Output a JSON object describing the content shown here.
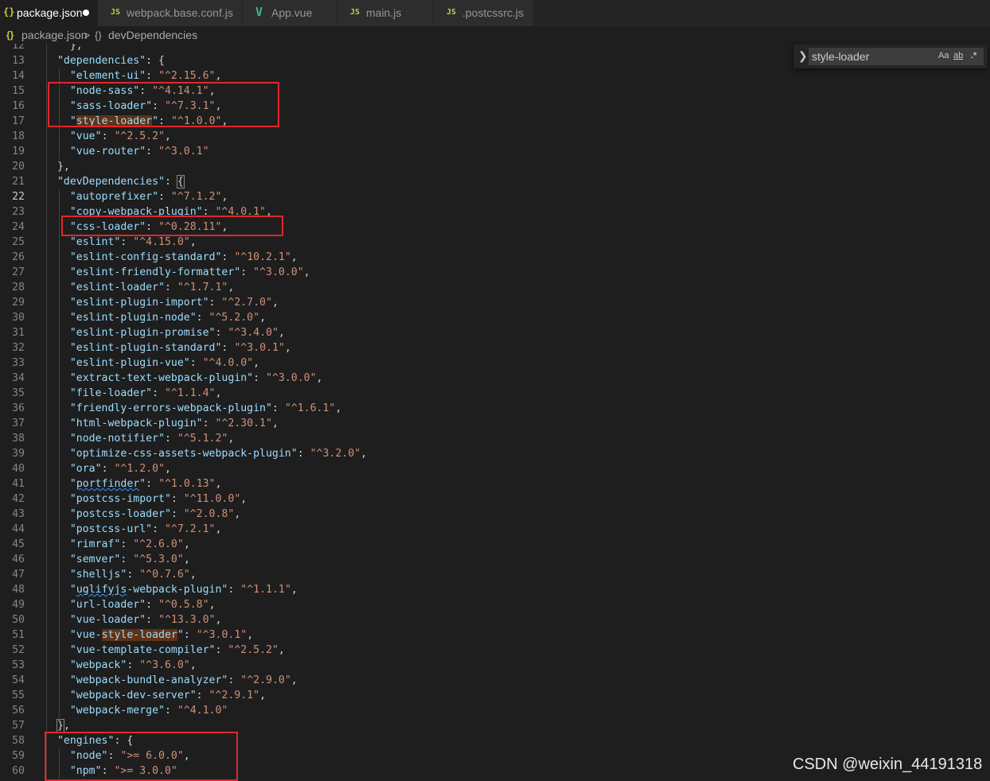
{
  "tabs": [
    {
      "label": "package.json",
      "icon": "{}",
      "active": true,
      "modified": true
    },
    {
      "label": "webpack.base.conf.js",
      "icon": "JS",
      "active": false
    },
    {
      "label": "App.vue",
      "icon": "V",
      "active": false
    },
    {
      "label": "main.js",
      "icon": "JS",
      "active": false
    },
    {
      "label": ".postcssrc.js",
      "icon": "JS",
      "active": false
    }
  ],
  "breadcrumb": {
    "file_icon": "{}",
    "file": "package.json",
    "separator": ">",
    "symbol_icon": "{}",
    "symbol": "devDependencies"
  },
  "find": {
    "value": "style-loader",
    "match_case": "Aa",
    "whole_word": "ab",
    "regex": ".*"
  },
  "watermark": "CSDN @weixin_44191318",
  "editor": {
    "current_line": 22,
    "lines": [
      {
        "n": 12,
        "t": "    },"
      },
      {
        "n": 13,
        "t": "  \"dependencies\": {"
      },
      {
        "n": 14,
        "t": "    \"element-ui\": \"^2.15.6\","
      },
      {
        "n": 15,
        "t": "    \"node-sass\": \"^4.14.1\","
      },
      {
        "n": 16,
        "t": "    \"sass-loader\": \"^7.3.1\","
      },
      {
        "n": 17,
        "t": "    \"style-loader\": \"^1.0.0\","
      },
      {
        "n": 18,
        "t": "    \"vue\": \"^2.5.2\","
      },
      {
        "n": 19,
        "t": "    \"vue-router\": \"^3.0.1\""
      },
      {
        "n": 20,
        "t": "  },"
      },
      {
        "n": 21,
        "t": "  \"devDependencies\": {"
      },
      {
        "n": 22,
        "t": "    \"autoprefixer\": \"^7.1.2\","
      },
      {
        "n": 23,
        "t": "    \"copy-webpack-plugin\": \"^4.0.1\","
      },
      {
        "n": 24,
        "t": "    \"css-loader\": \"^0.28.11\","
      },
      {
        "n": 25,
        "t": "    \"eslint\": \"^4.15.0\","
      },
      {
        "n": 26,
        "t": "    \"eslint-config-standard\": \"^10.2.1\","
      },
      {
        "n": 27,
        "t": "    \"eslint-friendly-formatter\": \"^3.0.0\","
      },
      {
        "n": 28,
        "t": "    \"eslint-loader\": \"^1.7.1\","
      },
      {
        "n": 29,
        "t": "    \"eslint-plugin-import\": \"^2.7.0\","
      },
      {
        "n": 30,
        "t": "    \"eslint-plugin-node\": \"^5.2.0\","
      },
      {
        "n": 31,
        "t": "    \"eslint-plugin-promise\": \"^3.4.0\","
      },
      {
        "n": 32,
        "t": "    \"eslint-plugin-standard\": \"^3.0.1\","
      },
      {
        "n": 33,
        "t": "    \"eslint-plugin-vue\": \"^4.0.0\","
      },
      {
        "n": 34,
        "t": "    \"extract-text-webpack-plugin\": \"^3.0.0\","
      },
      {
        "n": 35,
        "t": "    \"file-loader\": \"^1.1.4\","
      },
      {
        "n": 36,
        "t": "    \"friendly-errors-webpack-plugin\": \"^1.6.1\","
      },
      {
        "n": 37,
        "t": "    \"html-webpack-plugin\": \"^2.30.1\","
      },
      {
        "n": 38,
        "t": "    \"node-notifier\": \"^5.1.2\","
      },
      {
        "n": 39,
        "t": "    \"optimize-css-assets-webpack-plugin\": \"^3.2.0\","
      },
      {
        "n": 40,
        "t": "    \"ora\": \"^1.2.0\","
      },
      {
        "n": 41,
        "t": "    \"portfinder\": \"^1.0.13\","
      },
      {
        "n": 42,
        "t": "    \"postcss-import\": \"^11.0.0\","
      },
      {
        "n": 43,
        "t": "    \"postcss-loader\": \"^2.0.8\","
      },
      {
        "n": 44,
        "t": "    \"postcss-url\": \"^7.2.1\","
      },
      {
        "n": 45,
        "t": "    \"rimraf\": \"^2.6.0\","
      },
      {
        "n": 46,
        "t": "    \"semver\": \"^5.3.0\","
      },
      {
        "n": 47,
        "t": "    \"shelljs\": \"^0.7.6\","
      },
      {
        "n": 48,
        "t": "    \"uglifyjs-webpack-plugin\": \"^1.1.1\","
      },
      {
        "n": 49,
        "t": "    \"url-loader\": \"^0.5.8\","
      },
      {
        "n": 50,
        "t": "    \"vue-loader\": \"^13.3.0\","
      },
      {
        "n": 51,
        "t": "    \"vue-style-loader\": \"^3.0.1\","
      },
      {
        "n": 52,
        "t": "    \"vue-template-compiler\": \"^2.5.2\","
      },
      {
        "n": 53,
        "t": "    \"webpack\": \"^3.6.0\","
      },
      {
        "n": 54,
        "t": "    \"webpack-bundle-analyzer\": \"^2.9.0\","
      },
      {
        "n": 55,
        "t": "    \"webpack-dev-server\": \"^2.9.1\","
      },
      {
        "n": 56,
        "t": "    \"webpack-merge\": \"^4.1.0\""
      },
      {
        "n": 57,
        "t": "  },"
      },
      {
        "n": 58,
        "t": "  \"engines\": {"
      },
      {
        "n": 59,
        "t": "    \"node\": \">= 6.0.0\","
      },
      {
        "n": 60,
        "t": "    \"npm\": \">= 3.0.0\""
      }
    ]
  }
}
